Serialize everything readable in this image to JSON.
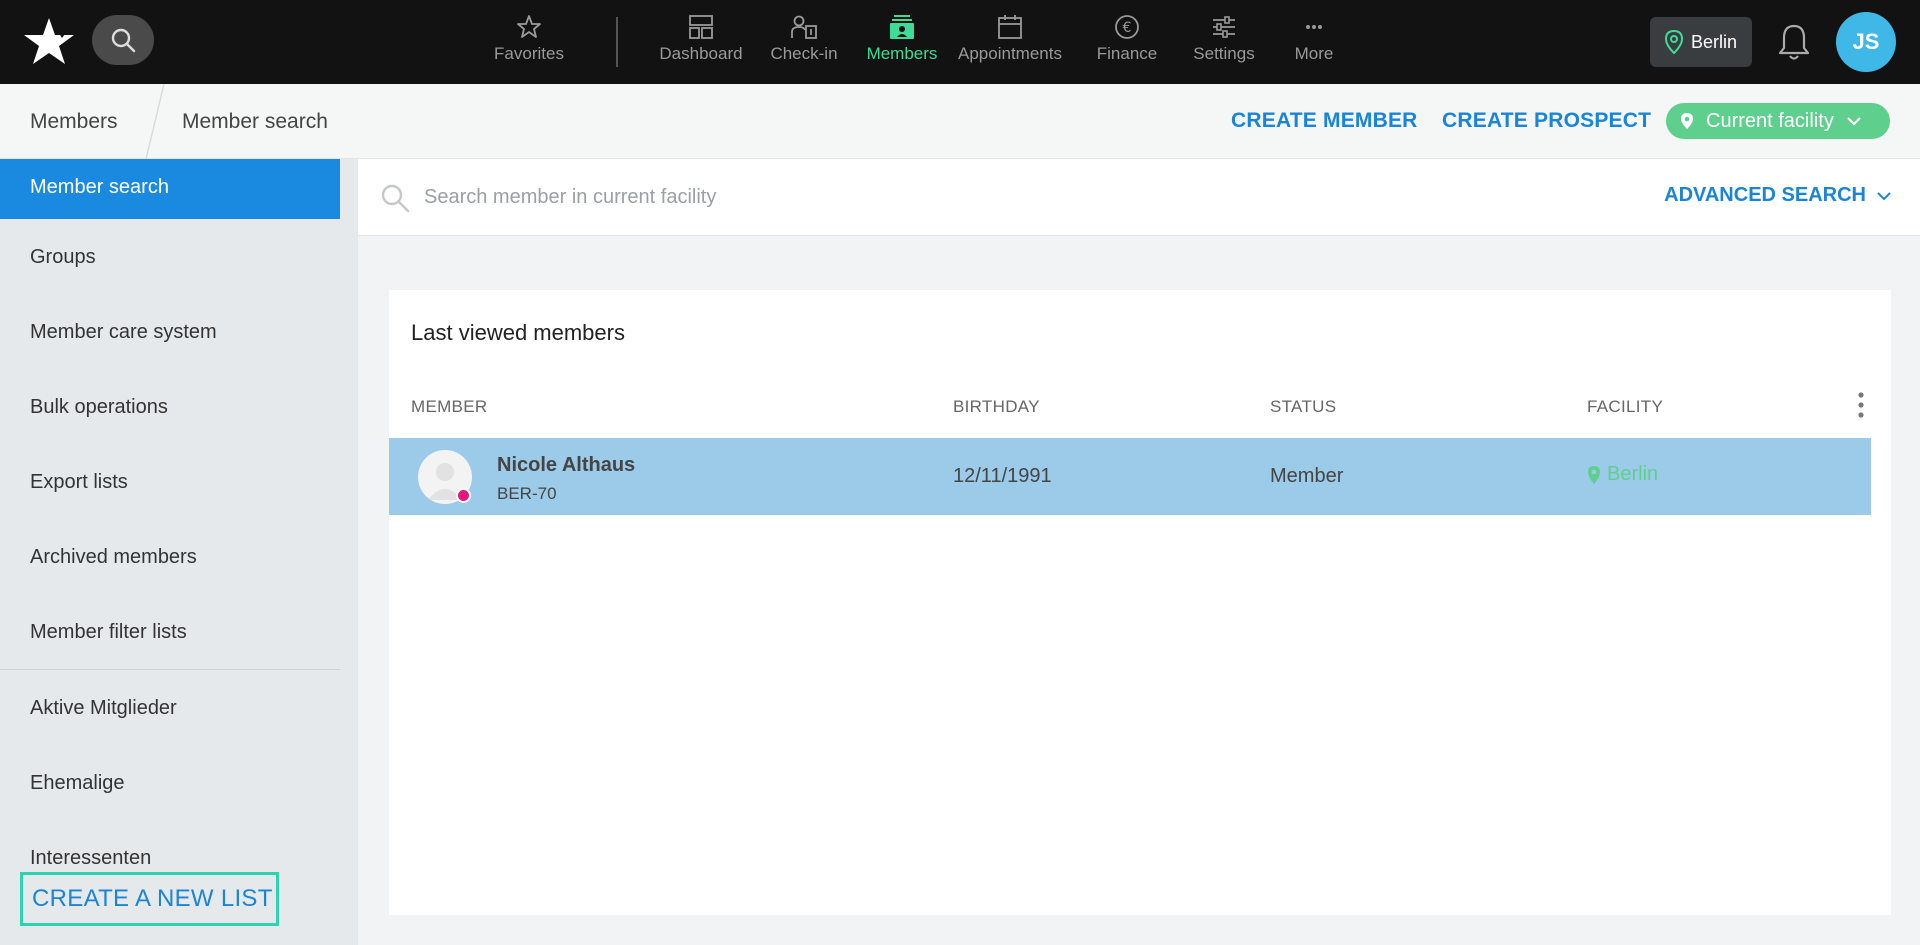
{
  "topnav": {
    "items": [
      {
        "label": "Favorites",
        "icon": "star-icon"
      },
      {
        "label": "Dashboard",
        "icon": "dashboard-icon"
      },
      {
        "label": "Check-in",
        "icon": "checkin-icon"
      },
      {
        "label": "Members",
        "icon": "members-icon",
        "active": true
      },
      {
        "label": "Appointments",
        "icon": "calendar-icon"
      },
      {
        "label": "Finance",
        "icon": "euro-icon"
      },
      {
        "label": "Settings",
        "icon": "sliders-icon"
      },
      {
        "label": "More",
        "icon": "more-icon"
      }
    ],
    "location": "Berlin",
    "user_initials": "JS"
  },
  "breadcrumb": {
    "root": "Members",
    "current": "Member search"
  },
  "actions": {
    "create_member": "CREATE MEMBER",
    "create_prospect": "CREATE PROSPECT",
    "facility_filter": "Current facility"
  },
  "sidebar": {
    "items": [
      {
        "label": "Member search",
        "active": true
      },
      {
        "label": "Groups"
      },
      {
        "label": "Member care system"
      },
      {
        "label": "Bulk operations"
      },
      {
        "label": "Export lists"
      },
      {
        "label": "Archived members"
      },
      {
        "label": "Member filter lists"
      },
      {
        "label": "Aktive Mitglieder"
      },
      {
        "label": "Ehemalige"
      },
      {
        "label": "Interessenten"
      }
    ],
    "create_list": "CREATE A NEW LIST"
  },
  "search": {
    "placeholder": "Search member in current facility",
    "advanced": "ADVANCED SEARCH"
  },
  "last_viewed": {
    "title": "Last viewed members",
    "columns": [
      "MEMBER",
      "BIRTHDAY",
      "STATUS",
      "FACILITY"
    ],
    "rows": [
      {
        "name": "Nicole Althaus",
        "id": "BER-70",
        "birthday": "12/11/1991",
        "status": "Member",
        "facility": "Berlin"
      }
    ]
  },
  "colors": {
    "accent_blue": "#1a85d6",
    "active_green": "#3ddc97",
    "facility_green": "#5fcf8e",
    "row_highlight": "#9bcbe9",
    "highlight_outline": "#2bd3b0"
  }
}
